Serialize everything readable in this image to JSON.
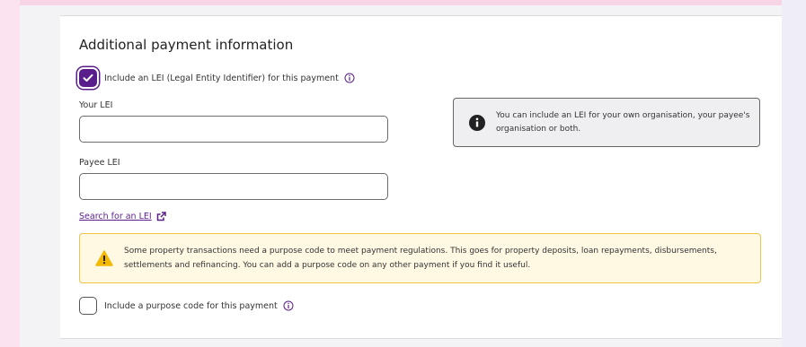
{
  "section": {
    "title": "Additional payment information",
    "lei_checkbox": {
      "label": "Include an LEI (Legal Entity Identifier) for this payment",
      "checked": true
    },
    "your_lei": {
      "label": "Your LEI",
      "value": ""
    },
    "payee_lei": {
      "label": "Payee LEI",
      "value": ""
    },
    "search_link": "Search for an LEI",
    "info_text": "You can include an LEI for your own organisation, your payee's organisation or both.",
    "warning_text": "Some property transactions need a purpose code to meet payment regulations. This goes for property deposits, loan repayments, disbursements, settlements and refinancing. You can add a purpose code on any other payment if you find it useful.",
    "purpose_checkbox": {
      "label": "Include a purpose code for this payment",
      "checked": false
    }
  },
  "colors": {
    "accent": "#5a1e8c",
    "warning": "#f5b800",
    "background": "#fbe3ef"
  },
  "icons": [
    "check-icon",
    "info-circle-icon",
    "info-filled-icon",
    "warning-triangle-icon",
    "external-link-icon"
  ]
}
